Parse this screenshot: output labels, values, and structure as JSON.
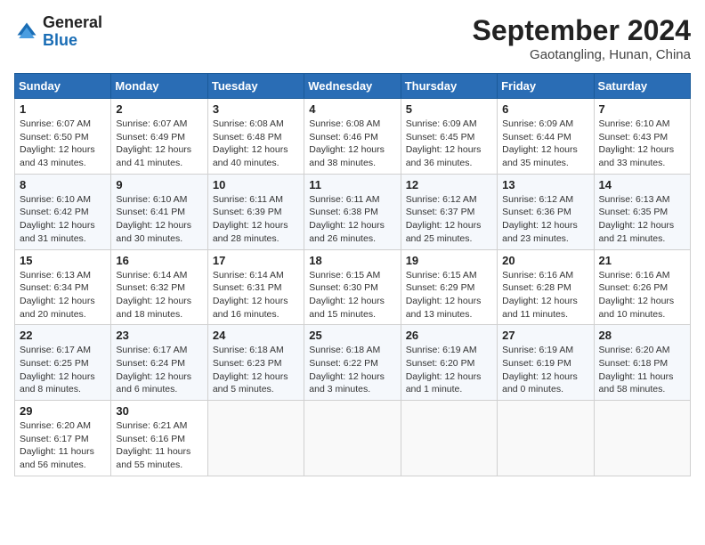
{
  "header": {
    "logo_general": "General",
    "logo_blue": "Blue",
    "month_title": "September 2024",
    "location": "Gaotangling, Hunan, China"
  },
  "weekdays": [
    "Sunday",
    "Monday",
    "Tuesday",
    "Wednesday",
    "Thursday",
    "Friday",
    "Saturday"
  ],
  "weeks": [
    [
      {
        "day": "1",
        "info": "Sunrise: 6:07 AM\nSunset: 6:50 PM\nDaylight: 12 hours\nand 43 minutes."
      },
      {
        "day": "2",
        "info": "Sunrise: 6:07 AM\nSunset: 6:49 PM\nDaylight: 12 hours\nand 41 minutes."
      },
      {
        "day": "3",
        "info": "Sunrise: 6:08 AM\nSunset: 6:48 PM\nDaylight: 12 hours\nand 40 minutes."
      },
      {
        "day": "4",
        "info": "Sunrise: 6:08 AM\nSunset: 6:46 PM\nDaylight: 12 hours\nand 38 minutes."
      },
      {
        "day": "5",
        "info": "Sunrise: 6:09 AM\nSunset: 6:45 PM\nDaylight: 12 hours\nand 36 minutes."
      },
      {
        "day": "6",
        "info": "Sunrise: 6:09 AM\nSunset: 6:44 PM\nDaylight: 12 hours\nand 35 minutes."
      },
      {
        "day": "7",
        "info": "Sunrise: 6:10 AM\nSunset: 6:43 PM\nDaylight: 12 hours\nand 33 minutes."
      }
    ],
    [
      {
        "day": "8",
        "info": "Sunrise: 6:10 AM\nSunset: 6:42 PM\nDaylight: 12 hours\nand 31 minutes."
      },
      {
        "day": "9",
        "info": "Sunrise: 6:10 AM\nSunset: 6:41 PM\nDaylight: 12 hours\nand 30 minutes."
      },
      {
        "day": "10",
        "info": "Sunrise: 6:11 AM\nSunset: 6:39 PM\nDaylight: 12 hours\nand 28 minutes."
      },
      {
        "day": "11",
        "info": "Sunrise: 6:11 AM\nSunset: 6:38 PM\nDaylight: 12 hours\nand 26 minutes."
      },
      {
        "day": "12",
        "info": "Sunrise: 6:12 AM\nSunset: 6:37 PM\nDaylight: 12 hours\nand 25 minutes."
      },
      {
        "day": "13",
        "info": "Sunrise: 6:12 AM\nSunset: 6:36 PM\nDaylight: 12 hours\nand 23 minutes."
      },
      {
        "day": "14",
        "info": "Sunrise: 6:13 AM\nSunset: 6:35 PM\nDaylight: 12 hours\nand 21 minutes."
      }
    ],
    [
      {
        "day": "15",
        "info": "Sunrise: 6:13 AM\nSunset: 6:34 PM\nDaylight: 12 hours\nand 20 minutes."
      },
      {
        "day": "16",
        "info": "Sunrise: 6:14 AM\nSunset: 6:32 PM\nDaylight: 12 hours\nand 18 minutes."
      },
      {
        "day": "17",
        "info": "Sunrise: 6:14 AM\nSunset: 6:31 PM\nDaylight: 12 hours\nand 16 minutes."
      },
      {
        "day": "18",
        "info": "Sunrise: 6:15 AM\nSunset: 6:30 PM\nDaylight: 12 hours\nand 15 minutes."
      },
      {
        "day": "19",
        "info": "Sunrise: 6:15 AM\nSunset: 6:29 PM\nDaylight: 12 hours\nand 13 minutes."
      },
      {
        "day": "20",
        "info": "Sunrise: 6:16 AM\nSunset: 6:28 PM\nDaylight: 12 hours\nand 11 minutes."
      },
      {
        "day": "21",
        "info": "Sunrise: 6:16 AM\nSunset: 6:26 PM\nDaylight: 12 hours\nand 10 minutes."
      }
    ],
    [
      {
        "day": "22",
        "info": "Sunrise: 6:17 AM\nSunset: 6:25 PM\nDaylight: 12 hours\nand 8 minutes."
      },
      {
        "day": "23",
        "info": "Sunrise: 6:17 AM\nSunset: 6:24 PM\nDaylight: 12 hours\nand 6 minutes."
      },
      {
        "day": "24",
        "info": "Sunrise: 6:18 AM\nSunset: 6:23 PM\nDaylight: 12 hours\nand 5 minutes."
      },
      {
        "day": "25",
        "info": "Sunrise: 6:18 AM\nSunset: 6:22 PM\nDaylight: 12 hours\nand 3 minutes."
      },
      {
        "day": "26",
        "info": "Sunrise: 6:19 AM\nSunset: 6:20 PM\nDaylight: 12 hours\nand 1 minute."
      },
      {
        "day": "27",
        "info": "Sunrise: 6:19 AM\nSunset: 6:19 PM\nDaylight: 12 hours\nand 0 minutes."
      },
      {
        "day": "28",
        "info": "Sunrise: 6:20 AM\nSunset: 6:18 PM\nDaylight: 11 hours\nand 58 minutes."
      }
    ],
    [
      {
        "day": "29",
        "info": "Sunrise: 6:20 AM\nSunset: 6:17 PM\nDaylight: 11 hours\nand 56 minutes."
      },
      {
        "day": "30",
        "info": "Sunrise: 6:21 AM\nSunset: 6:16 PM\nDaylight: 11 hours\nand 55 minutes."
      },
      null,
      null,
      null,
      null,
      null
    ]
  ]
}
